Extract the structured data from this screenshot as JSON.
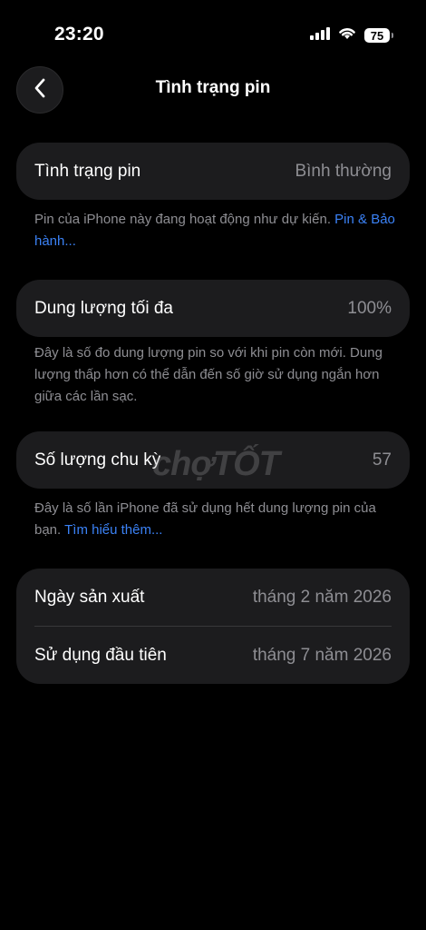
{
  "status_bar": {
    "time": "23:20",
    "battery_level": "75"
  },
  "nav": {
    "title": "Tình trạng pin",
    "back_icon": "chevron-left-icon"
  },
  "battery_health": {
    "label": "Tình trạng pin",
    "value": "Bình thường",
    "note_text": "Pin của iPhone này đang hoạt động như dự kiến.",
    "note_link": "Pin & Bảo hành..."
  },
  "max_capacity": {
    "label": "Dung lượng tối đa",
    "value": "100%",
    "note_text": "Đây là số đo dung lượng pin so với khi pin còn mới. Dung lượng thấp hơn có thể dẫn đến số giờ sử dụng ngắn hơn giữa các lần sạc."
  },
  "cycle_count": {
    "label": "Số lượng chu kỳ",
    "value": "57",
    "note_text": "Đây là số lần iPhone đã sử dụng hết dung lượng pin của bạn.",
    "note_link": "Tìm hiểu thêm..."
  },
  "dates": {
    "manufacture_label": "Ngày sản xuất",
    "manufacture_value": "tháng 2 năm 2026",
    "first_use_label": "Sử dụng đầu tiên",
    "first_use_value": "tháng 7 năm 2026"
  },
  "watermark": "chợTỐT",
  "colors": {
    "background": "#000000",
    "card": "#1c1c1e",
    "secondary_text": "#8e8e93",
    "link": "#3b82f6"
  }
}
